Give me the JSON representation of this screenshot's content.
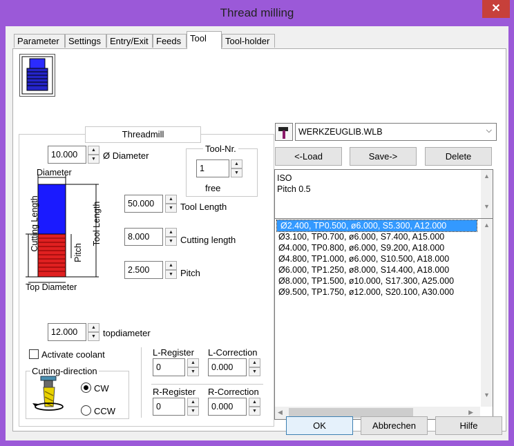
{
  "window": {
    "title": "Thread milling",
    "close": "✕"
  },
  "tabs": [
    "Parameter",
    "Settings",
    "Entry/Exit",
    "Feeds",
    "Tool",
    "Tool-holder"
  ],
  "tool": {
    "section_title": "Threadmill",
    "diameter": {
      "value": "10.000",
      "label": "Ø Diameter"
    },
    "tool_nr": {
      "legend": "Tool-Nr.",
      "value": "1",
      "status": "free"
    },
    "tool_length": {
      "value": "50.000",
      "label": "Tool Length"
    },
    "cutting_length": {
      "value": "8.000",
      "label": "Cutting length"
    },
    "pitch": {
      "value": "2.500",
      "label": "Pitch"
    },
    "topdiameter": {
      "value": "12.000",
      "label": "topdiameter"
    },
    "diagram": {
      "diameter": "Diameter",
      "cutting_length": "Cutting Length",
      "pitch": "Pitch",
      "tool_length": "Tool Length",
      "top_diameter": "Top Diameter"
    },
    "coolant": {
      "label": "Activate coolant",
      "checked": false
    },
    "cutting_direction": {
      "legend": "Cutting-direction",
      "options": [
        "CW",
        "CCW"
      ],
      "selected": "CW"
    },
    "l_register": {
      "label": "L-Register",
      "value": "0"
    },
    "l_correction": {
      "label": "L-Correction",
      "value": "0.000"
    },
    "r_register": {
      "label": "R-Register",
      "value": "0"
    },
    "r_correction": {
      "label": "R-Correction",
      "value": "0.000"
    }
  },
  "library": {
    "file": "WERKZEUGLIB.WLB",
    "load": "<-Load",
    "save": "Save->",
    "delete": "Delete",
    "info": [
      "ISO",
      "Pitch 0.5"
    ],
    "items": [
      "Ø2.400, TP0.500, ø6.000, S5.300, A12.000",
      "Ø3.100, TP0.700, ø6.000, S7.400, A15.000",
      "Ø4.000, TP0.800, ø6.000, S9.200, A18.000",
      "Ø4.800, TP1.000, ø6.000, S10.500, A18.000",
      "Ø6.000, TP1.250, ø8.000, S14.400, A18.000",
      "Ø8.000, TP1.500, ø10.000, S17.300, A25.000",
      "Ø9.500, TP1.750, ø12.000, S20.100, A30.000"
    ],
    "selected_index": 0
  },
  "footer": {
    "ok": "OK",
    "cancel": "Abbrechen",
    "help": "Hilfe"
  },
  "colors": {
    "frame": "#9b59d8",
    "selection": "#3399ff",
    "tool_body": "#1a1aff",
    "tool_thread": "#e02020"
  }
}
